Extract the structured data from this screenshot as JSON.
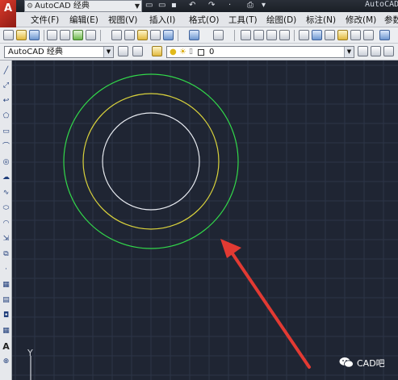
{
  "window": {
    "workspace_title": "AutoCAD 经典",
    "app_title": "AutoCAD"
  },
  "menu": {
    "items": [
      "文件(F)",
      "编辑(E)",
      "视图(V)",
      "插入(I)",
      "格式(O)",
      "工具(T)",
      "绘图(D)",
      "标注(N)",
      "修改(M)",
      "参数"
    ]
  },
  "workspace_combo": {
    "value": "AutoCAD 经典"
  },
  "layer_combo": {
    "value": "0"
  },
  "drawing": {
    "circles": [
      {
        "color": "#32d84a",
        "name": "outer-circle"
      },
      {
        "color": "#d9d23c",
        "name": "middle-circle"
      },
      {
        "color": "#e9ecf2",
        "name": "inner-circle"
      }
    ],
    "arrow_color": "#e23a33",
    "background": "#1f2533",
    "grid_color": "#2c3547"
  },
  "ucs": {
    "y_label": "Y"
  },
  "watermark": {
    "text": "CAD吧"
  },
  "icons": {
    "title_quick_access": [
      "new-icon",
      "open-icon",
      "save-icon",
      "undo-icon",
      "redo-icon",
      "plot-icon"
    ],
    "standard_toolbar": [
      "new-icon",
      "open-icon",
      "save-icon",
      "print-icon",
      "preview-icon",
      "publish-icon",
      "cut-icon",
      "copy-icon",
      "paste-icon",
      "matchprop-icon",
      "block-icon",
      "undo-icon",
      "redo-icon",
      "pan-icon",
      "zoom-realtime-icon",
      "zoom-window-icon",
      "zoom-previous-icon",
      "properties-icon",
      "design-center-icon",
      "tool-palettes-icon",
      "sheet-set-icon",
      "markup-icon",
      "calculator-icon",
      "help-icon"
    ],
    "left_draw": [
      "line-icon",
      "xline-icon",
      "polyline-icon",
      "polygon-icon",
      "rectangle-icon",
      "arc-icon",
      "circle-icon",
      "revcloud-icon",
      "spline-icon",
      "ellipse-icon",
      "ellipse-arc-icon",
      "insert-block-icon",
      "make-block-icon",
      "point-icon",
      "hatch-icon",
      "gradient-icon",
      "region-icon",
      "table-icon",
      "text-icon",
      "add-selected-icon"
    ]
  }
}
